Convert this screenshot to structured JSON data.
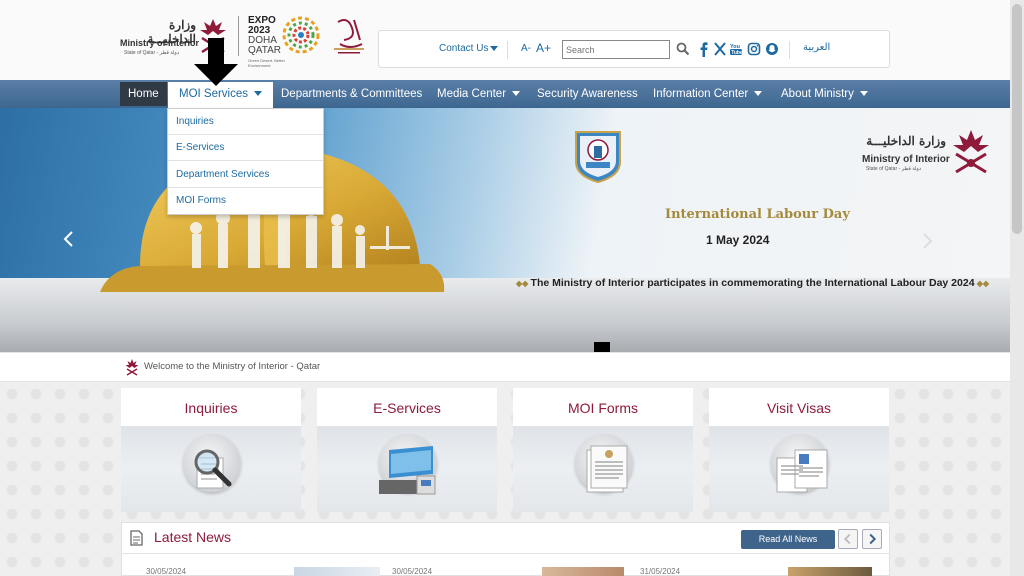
{
  "header": {
    "logo": {
      "arabic": "وزارة الداخليـــة",
      "english": "Ministry of Interior",
      "sub": "State of Qatar - دولة قطر"
    },
    "expo": {
      "lines": [
        "EXPO",
        "2023",
        "DOHA",
        "QATAR"
      ],
      "sub": "Green Desert, Better Environment"
    }
  },
  "utility": {
    "contact_label": "Contact Us",
    "font_decrease": "A-",
    "font_increase": "A+",
    "search_placeholder": "Search",
    "social_icons": [
      "facebook-icon",
      "x-icon",
      "youtube-icon",
      "instagram-icon",
      "snapchat-icon"
    ],
    "language_link": "العربية"
  },
  "nav": {
    "items": [
      {
        "label": "Home",
        "dropdown": false
      },
      {
        "label": "MOI Services",
        "dropdown": true,
        "active": true
      },
      {
        "label": "Departments & Committees",
        "dropdown": false
      },
      {
        "label": "Media Center",
        "dropdown": true
      },
      {
        "label": "Security Awareness",
        "dropdown": false
      },
      {
        "label": "Information Center",
        "dropdown": true
      },
      {
        "label": "About Ministry",
        "dropdown": true
      }
    ]
  },
  "dropdown": {
    "items": [
      "Inquiries",
      "E-Services",
      "Department Services",
      "MOI Forms"
    ]
  },
  "hero": {
    "logo_arabic": "وزارة الداخليـــة",
    "logo_english": "Ministry of Interior",
    "logo_sub": "State of Qatar - دولة قطر",
    "title": "International Labour Day",
    "date": "1 May 2024",
    "caption": "The Ministry of Interior participates in commemorating the International Labour Day 2024"
  },
  "welcome": {
    "text": "Welcome to the Ministry of Interior - Qatar"
  },
  "cards": [
    {
      "title": "Inquiries",
      "icon": "magnifier-document-icon"
    },
    {
      "title": "E-Services",
      "icon": "computer-services-icon"
    },
    {
      "title": "MOI Forms",
      "icon": "forms-document-icon"
    },
    {
      "title": "Visit Visas",
      "icon": "visa-documents-icon"
    }
  ],
  "news": {
    "title": "Latest News",
    "read_all": "Read All News",
    "dates": [
      "30/05/2024",
      "30/05/2024",
      "31/05/2024"
    ]
  },
  "colors": {
    "nav_blue": "#3d6790",
    "maroon": "#8e1b3a",
    "link_blue": "#1d6aa0",
    "gold": "#a48a3a"
  }
}
